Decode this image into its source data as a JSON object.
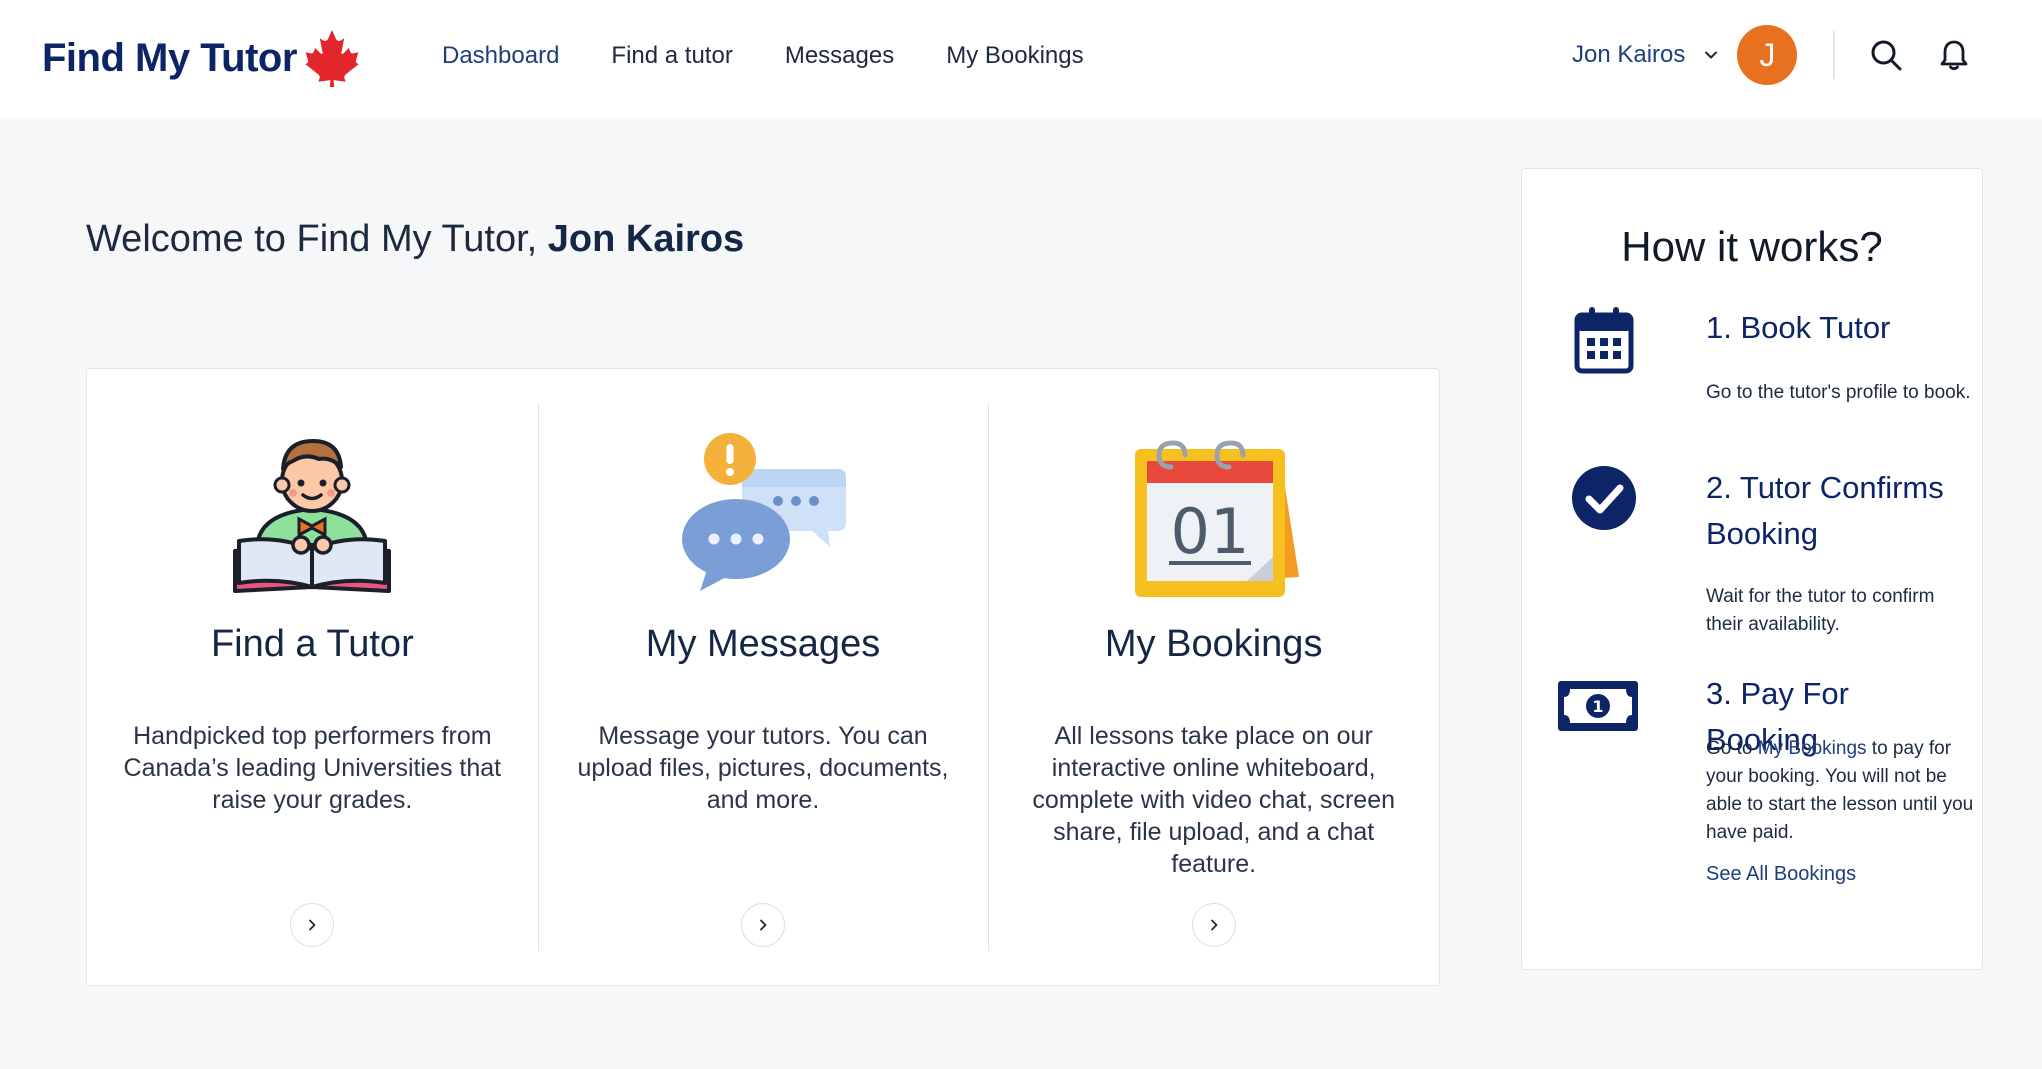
{
  "header": {
    "brand": "Find My Tutor",
    "brand_icon": "maple-leaf-icon",
    "brand_color": "#0d2466",
    "accent_red": "#e3262b",
    "nav": [
      {
        "label": "Dashboard",
        "active": true
      },
      {
        "label": "Find a tutor"
      },
      {
        "label": "Messages"
      },
      {
        "label": "My Bookings"
      }
    ],
    "user": {
      "name": "Jon Kairos",
      "initial": "J",
      "avatar_color": "#e8711f"
    },
    "icons": [
      "search-icon",
      "bell-icon"
    ]
  },
  "welcome": {
    "prefix": "Welcome to Find My Tutor, ",
    "name": "Jon Kairos"
  },
  "cards": [
    {
      "title": "Find a Tutor",
      "description": "Handpicked top performers from Canada’s leading Universities that raise your grades.",
      "icon": "student-reading-icon"
    },
    {
      "title": "My Messages",
      "description": "Message your tutors. You can upload files, pictures, documents, and more.",
      "icon": "chat-bubbles-icon"
    },
    {
      "title": "My Bookings",
      "description": "All lessons take place on our interactive online whiteboard, complete with video chat, screen share, file upload, and a chat feature.",
      "icon": "calendar-icon",
      "calendar_day": "01"
    }
  ],
  "how_it_works": {
    "title": "How it works?",
    "steps": [
      {
        "title": "1. Book Tutor",
        "description": "Go to the tutor's profile to book.",
        "icon": "calendar-icon"
      },
      {
        "title": "2. Tutor Confirms Booking",
        "description": "Wait for the tutor to confirm their availability.",
        "icon": "check-circle-icon"
      },
      {
        "title": "3. Pay For Booking",
        "description_prefix": "Go to ",
        "description_link": "My Bookings",
        "description_suffix": " to pay for your booking. You will not be able to start the lesson until you have paid.",
        "icon": "money-bill-icon",
        "bill_number": "1"
      }
    ],
    "see_all": "See All Bookings"
  }
}
